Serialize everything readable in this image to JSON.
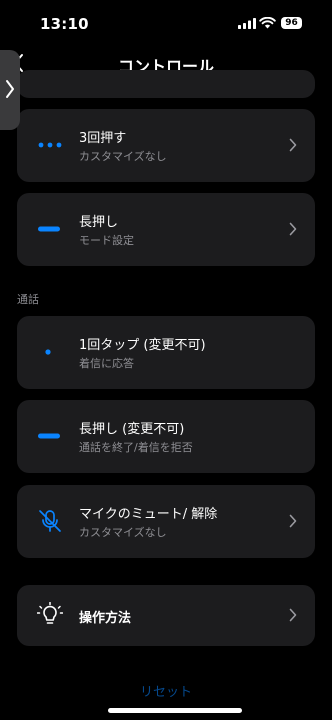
{
  "status": {
    "time": "13:10",
    "battery": "96"
  },
  "nav": {
    "title": "コントロール"
  },
  "rows": {
    "triple_press": {
      "title": "3回押す",
      "subtitle": "カスタマイズなし"
    },
    "long_press": {
      "title": "長押し",
      "subtitle": "モード設定"
    },
    "call_single_tap": {
      "title": "1回タップ (変更不可)",
      "subtitle": "着信に応答"
    },
    "call_long_press": {
      "title": "長押し (変更不可)",
      "subtitle": "通話を終了/着信を拒否"
    },
    "mic_mute": {
      "title": "マイクのミュート/ 解除",
      "subtitle": "カスタマイズなし"
    },
    "how_to": {
      "title": "操作方法"
    }
  },
  "sections": {
    "calls": "通話"
  },
  "footer": {
    "reset": "リセット"
  },
  "colors": {
    "accent": "#0a84ff",
    "card": "#1c1c1e",
    "background": "#000000",
    "muted": "#8e8e93"
  },
  "icons": [
    "back-chevron-icon",
    "dots-icon",
    "dash-icon",
    "dot-icon",
    "mic-off-icon",
    "lightbulb-icon",
    "chevron-right-icon",
    "expand-chevron-icon"
  ]
}
